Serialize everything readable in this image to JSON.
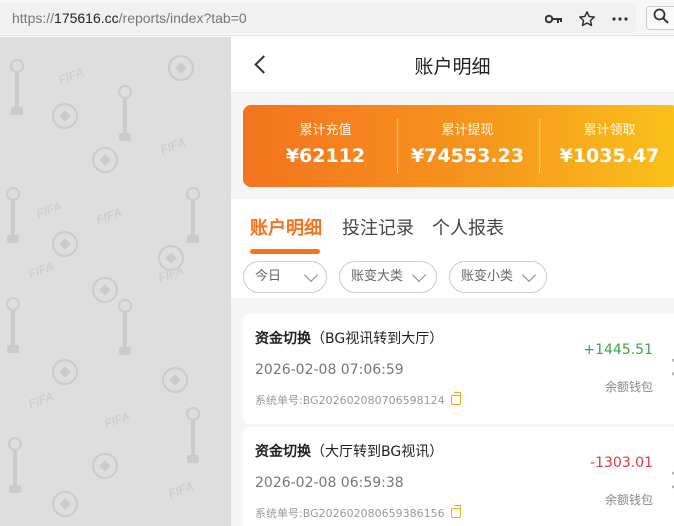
{
  "browser": {
    "url_scheme": "https://",
    "url_host": "175616.cc",
    "url_path": "/reports/index?tab=0"
  },
  "background": {
    "watermark": "FIFA"
  },
  "header": {
    "title": "账户明细"
  },
  "summary": {
    "items": [
      {
        "label": "累计充值",
        "value": "¥62112"
      },
      {
        "label": "累计提现",
        "value": "¥74553.23"
      },
      {
        "label": "累计领取",
        "value": "¥1035.47"
      }
    ]
  },
  "tabs": [
    {
      "label": "账户明细",
      "active": true
    },
    {
      "label": "投注记录",
      "active": false
    },
    {
      "label": "个人报表",
      "active": false
    }
  ],
  "filters": [
    {
      "label": "今日"
    },
    {
      "label": "账变大类"
    },
    {
      "label": "账变小类"
    }
  ],
  "records": [
    {
      "type": "资金切换",
      "detail": "（BG视讯转到大厅）",
      "time": "2026-02-08 07:06:59",
      "order_label": "系统单号:",
      "order_no": "BG202602080706598124",
      "amount": "+1445.51",
      "wallet": "余额钱包"
    },
    {
      "type": "资金切换",
      "detail": "（大厅转到BG视讯）",
      "time": "2026-02-08 06:59:38",
      "order_label": "系统单号:",
      "order_no": "BG202602080659386156",
      "amount": "-1303.01",
      "wallet": "余额钱包"
    }
  ],
  "colors": {
    "accent": "#f4731f",
    "positive": "#3aa64a",
    "negative": "#e03a3a"
  }
}
